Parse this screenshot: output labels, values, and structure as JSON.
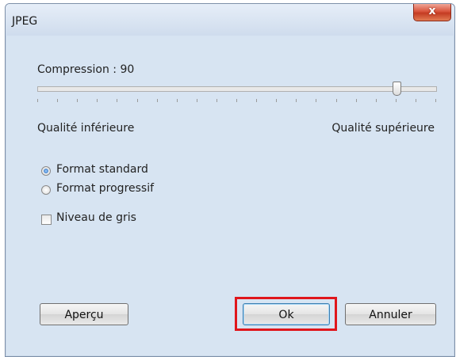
{
  "window": {
    "title": "JPEG",
    "close_label": "x"
  },
  "compression": {
    "label": "Compression : 90",
    "value": 90,
    "min": 0,
    "max": 100
  },
  "quality": {
    "low_label": "Qualité inférieure",
    "high_label": "Qualité supérieure"
  },
  "format": {
    "options": [
      {
        "label": "Format standard",
        "checked": true
      },
      {
        "label": "Format progressif",
        "checked": false
      }
    ]
  },
  "grayscale": {
    "label": "Niveau de gris",
    "checked": false
  },
  "buttons": {
    "preview": "Aperçu",
    "ok": "Ok",
    "cancel": "Annuler"
  },
  "colors": {
    "highlight": "#e0161c",
    "close_button": "#c43b22"
  }
}
